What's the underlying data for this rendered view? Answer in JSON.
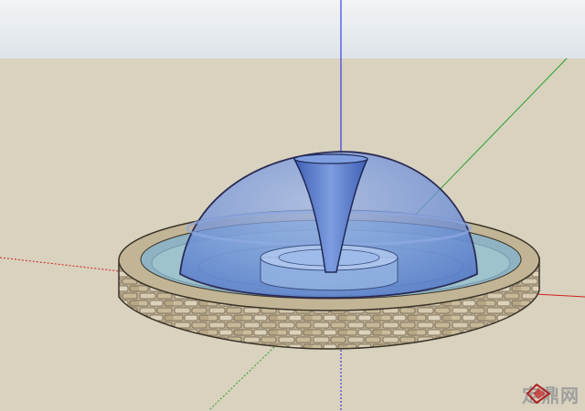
{
  "scene": {
    "sky_color": "#e6ebef",
    "ground_color": "#d8d2bf",
    "axis_colors": {
      "red": "#d02020",
      "green": "#2aa12a",
      "blue": "#1e1ee0"
    },
    "water_color": "#6f93d6",
    "stone_color": "#b9a98a"
  },
  "watermark": {
    "text": "定鼎网",
    "icon": "dingding-logo-icon"
  }
}
